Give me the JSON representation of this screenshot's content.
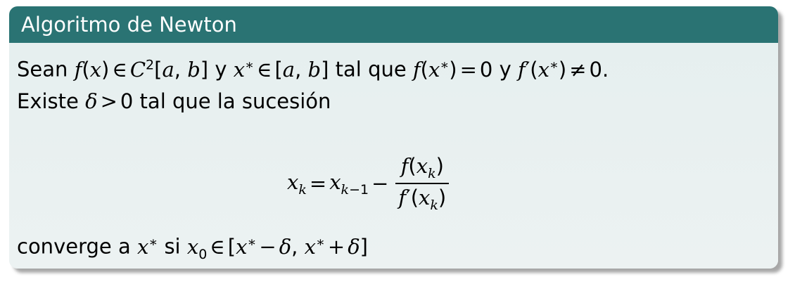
{
  "block": {
    "title": "Algoritmo de Newton",
    "line1_words": {
      "sean": "Sean",
      "y1": "y",
      "tal_que": "tal que",
      "y2": "y"
    },
    "line2_words": {
      "existe": "Existe",
      "rest": "tal que la sucesión"
    },
    "line3_words": {
      "converge": "converge a",
      "si": "si"
    }
  },
  "colors": {
    "title_bar": "#2a7373",
    "body_bg": "#eaf1f1"
  }
}
